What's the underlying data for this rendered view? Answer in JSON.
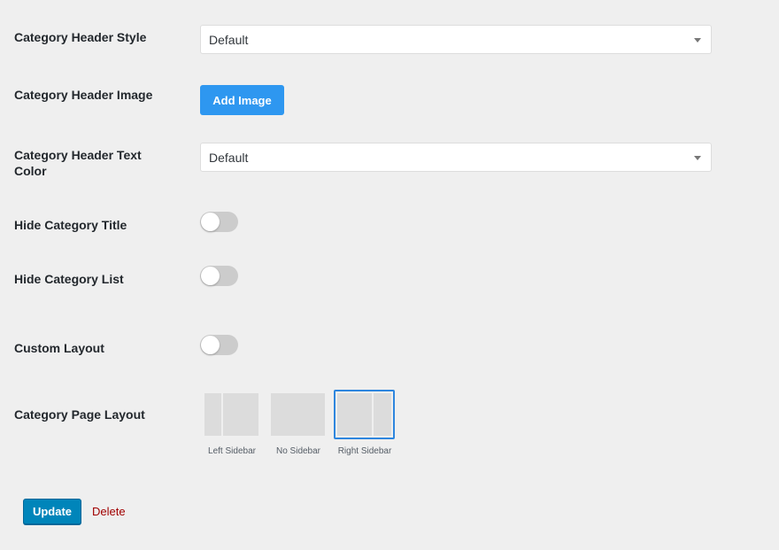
{
  "fields": {
    "header_style": {
      "label": "Category Header Style",
      "value": "Default"
    },
    "header_image": {
      "label": "Category Header Image",
      "button_label": "Add Image"
    },
    "header_text_color": {
      "label_line1": "Category Header Text",
      "label_line2": "Color",
      "value": "Default"
    },
    "hide_title": {
      "label": "Hide Category Title",
      "enabled": false
    },
    "hide_list": {
      "label": "Hide Category List",
      "enabled": false
    },
    "custom_layout": {
      "label": "Custom Layout",
      "enabled": false
    },
    "page_layout": {
      "label": "Category Page Layout",
      "options": [
        {
          "label": "Left Sidebar",
          "selected": false
        },
        {
          "label": "No Sidebar",
          "selected": false
        },
        {
          "label": "Right Sidebar",
          "selected": true
        }
      ]
    }
  },
  "actions": {
    "update_label": "Update",
    "delete_label": "Delete"
  },
  "colors": {
    "background": "#efefef",
    "primary_button": "#2e97f0",
    "update_button": "#0085ba",
    "delete_link": "#a00000",
    "selected_border": "#2e86de",
    "toggle_off": "#cccccc"
  }
}
